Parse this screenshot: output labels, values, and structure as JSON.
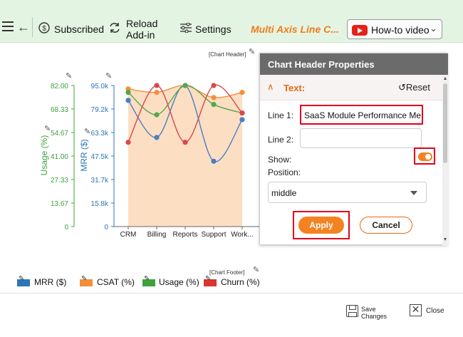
{
  "toolbar": {
    "subscribed_label": "Subscribed",
    "reload_label_1": "Reload",
    "reload_label_2": "Add-in",
    "settings_label": "Settings",
    "app_title": "Multi Axis Line C...",
    "howto_label": "How-to video",
    "accent_color": "#f07d1a"
  },
  "chart": {
    "header_placeholder": "[Chart Header]",
    "footer_placeholder": "[Chart Footer]",
    "usage_axis_title": "Usage (%)",
    "mrr_axis_title": "MRR ($)",
    "usage_ticks": [
      "82.00",
      "68.33",
      "54.67",
      "41.00",
      "27.33",
      "13.67",
      "0"
    ],
    "mrr_ticks": [
      "95.0k",
      "79.2k",
      "63.3k",
      "47.5k",
      "31.7k",
      "15.8k",
      "0"
    ],
    "categories": [
      "CRM",
      "Billing",
      "Reports",
      "Support",
      "Work..."
    ]
  },
  "chart_data": {
    "type": "line",
    "categories": [
      "CRM",
      "Billing",
      "Reports",
      "Support",
      "Work..."
    ],
    "yaxes": [
      {
        "label": "Usage (%)",
        "range": [
          0,
          82
        ],
        "color": "#3da33d"
      },
      {
        "label": "MRR ($)",
        "range": [
          0,
          95000
        ],
        "color": "#2e75b6"
      }
    ],
    "series": [
      {
        "name": "MRR ($)",
        "axis": "MRR ($)",
        "color": "#4a7fc1",
        "values": [
          85000,
          60000,
          95000,
          44000,
          72000
        ]
      },
      {
        "name": "CSAT (%)",
        "axis": "Usage (%)",
        "color": "#f58e3c",
        "values": [
          80,
          78,
          82,
          75,
          78
        ],
        "area": true
      },
      {
        "name": "Usage (%)",
        "axis": "Usage (%)",
        "color": "#54a84a",
        "values": [
          78,
          65,
          82,
          71,
          66
        ]
      },
      {
        "name": "Churn (%)",
        "axis": "Usage (%)",
        "color": "#d9484a",
        "values": [
          49,
          82,
          49,
          82,
          66
        ]
      }
    ],
    "visible_categories": 4.6,
    "legend_position": "bottom-left"
  },
  "panel": {
    "title": "Chart Header Properties",
    "section_label": "Text:",
    "reset_label": "Reset",
    "line1_label": "Line 1:",
    "line1_value": "SaaS Module Performance Me",
    "line2_label": "Line 2:",
    "line2_value": "",
    "show_label": "Show:",
    "show_on": true,
    "position_label": "Position:",
    "position_value": "middle",
    "apply_label": "Apply",
    "cancel_label": "Cancel"
  },
  "legend": [
    {
      "label": "MRR ($)",
      "color": "#2e75b6"
    },
    {
      "label": "CSAT (%)",
      "color": "#f58e3c"
    },
    {
      "label": "Usage (%)",
      "color": "#3da33d"
    },
    {
      "label": "Churn (%)",
      "color": "#d9352f"
    }
  ],
  "bottom": {
    "save_label_1": "Save",
    "save_label_2": "Changes",
    "close_label": "Close"
  }
}
